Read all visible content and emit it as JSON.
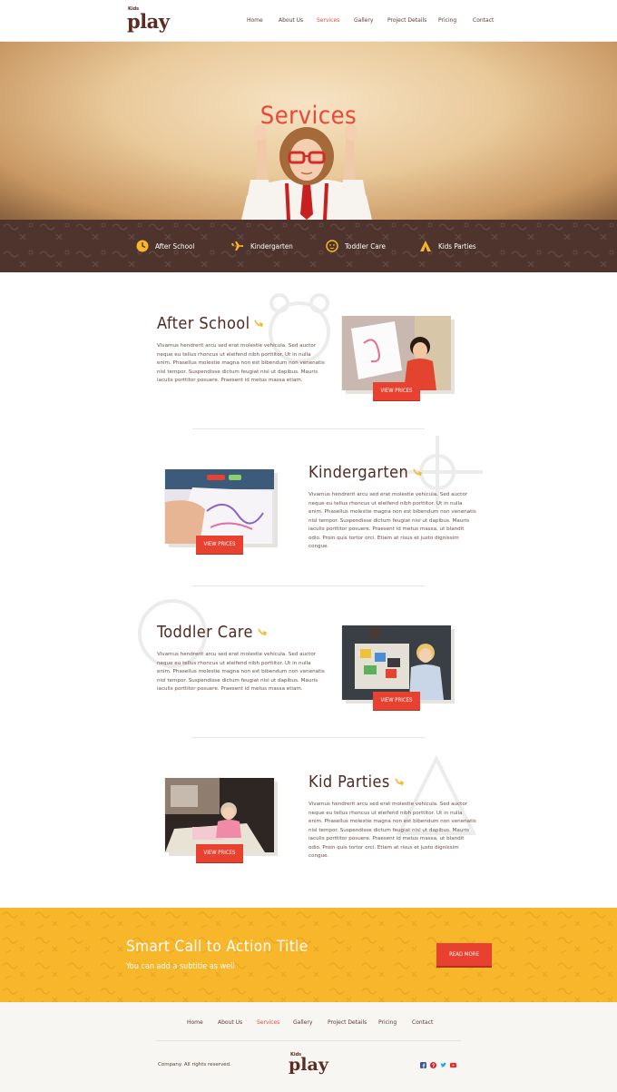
{
  "brand": {
    "logo_small": "Kids",
    "logo_big": "play"
  },
  "nav": {
    "items": [
      {
        "label": "Home",
        "active": false
      },
      {
        "label": "About Us",
        "active": false
      },
      {
        "label": "Services",
        "active": true
      },
      {
        "label": "Gallery",
        "active": false
      },
      {
        "label": "Project Details",
        "active": false
      },
      {
        "label": "Pricing",
        "active": false
      },
      {
        "label": "Contact",
        "active": false
      }
    ]
  },
  "hero": {
    "title": "Services"
  },
  "categories": [
    {
      "label": "After School",
      "icon": "clock-icon"
    },
    {
      "label": "Kindergarten",
      "icon": "airplane-icon"
    },
    {
      "label": "Toddler Care",
      "icon": "baby-face-icon"
    },
    {
      "label": "Kids Parties",
      "icon": "tent-icon"
    }
  ],
  "services": [
    {
      "title": "After School",
      "text": "Vivamus hendrerit arcu sed erat molestie vehicula. Sed auctor neque eu tellus rhoncus ut eleifend nibh porttitor. Ut in nulla enim. Phasellus molestie magna non est bibendum non venenatis nisl tempor. Suspendisse dictum feugiat nisl ut dapibus. Mauris iaculis porttitor posuere. Praesent id metus massa etiam.",
      "button": "VIEW PRICES"
    },
    {
      "title": "Kindergarten",
      "text": "Vivamus hendrerit arcu sed erat molestie vehicula. Sed auctor neque eu tellus rhoncus ut eleifend nibh porttitor. Ut in nulla enim. Phasellus molestie magna non est bibendum non venenatis nisl tempor. Suspendisse dictum feugiat nisl ut dapibus. Mauris iaculis porttitor posuere. Praesent id metus massa, ut blandit odio. Proin quis tortor orci. Etiam at risus et justo dignissim congue.",
      "button": "VIEW PRICES"
    },
    {
      "title": "Toddler Care",
      "text": "Vivamus hendrerit arcu sed erat molestie vehicula. Sed auctor neque eu tellus rhoncus ut eleifend nibh porttitor. Ut in nulla enim. Phasellus molestie magna non est bibendum non venenatis nisl tempor. Suspendisse dictum feugiat nisl ut dapibus. Mauris iaculis porttitor posuere. Praesent id metus massa etiam.",
      "button": "VIEW PRICES"
    },
    {
      "title": "Kid Parties",
      "text": "Vivamus hendrerit arcu sed erat molestie vehicula. Sed auctor neque eu tellus rhoncus ut eleifend nibh porttitor. Ut in nulla enim. Phasellus molestie magna non est bibendum non venenatis nisl tempor. Suspendisse dictum feugiat nisl ut dapibus. Mauris iaculis porttitor posuere. Praesent id metus massa, ut blandit odio. Proin quis tortor orci. Etiam at risus et justo dignissim congue.",
      "button": "VIEW PRICES"
    }
  ],
  "cta": {
    "title": "Smart Call to Action Title",
    "subtitle": "You can add a subtitle as well",
    "button": "READ MORE"
  },
  "footer": {
    "nav": [
      "Home",
      "About Us",
      "Services",
      "Gallery",
      "Project Details",
      "Pricing",
      "Contact"
    ],
    "active_index": 2,
    "copyright": "Company. All rights reserved.",
    "social": [
      {
        "icon": "facebook-icon",
        "color": "#3b5998"
      },
      {
        "icon": "pinterest-icon",
        "color": "#cb2027"
      },
      {
        "icon": "twitter-icon",
        "color": "#1da1f2"
      },
      {
        "icon": "youtube-icon",
        "color": "#e52d27"
      }
    ]
  },
  "colors": {
    "accent": "#e8473a",
    "brown": "#4e342c",
    "yellow": "#f8b62b",
    "button": "#e8412f"
  }
}
